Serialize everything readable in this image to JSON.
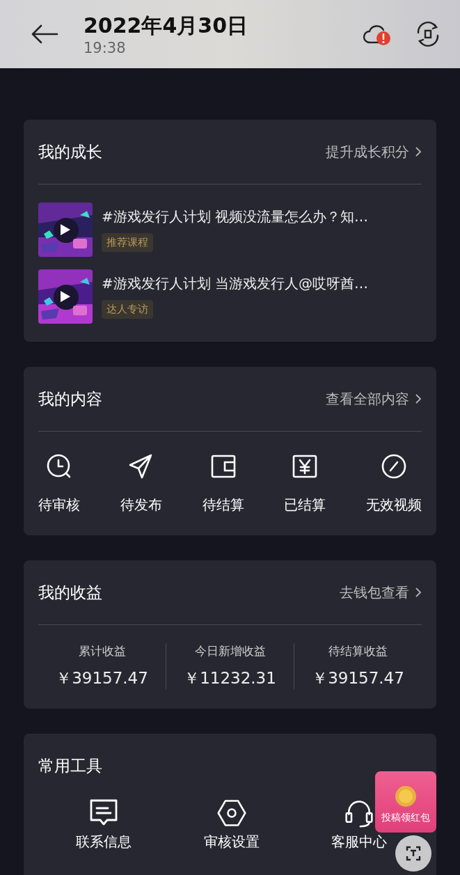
{
  "header": {
    "title": "2022年4月30日",
    "time": "19:38"
  },
  "growth": {
    "title": "我的成长",
    "link": "提升成长积分",
    "items": [
      {
        "title": "#游戏发行人计划 视频没流量怎么办？知…",
        "tag": "推荐课程"
      },
      {
        "title": "#游戏发行人计划 当游戏发行人@哎呀酋…",
        "tag": "达人专访"
      }
    ]
  },
  "content": {
    "title": "我的内容",
    "link": "查看全部内容",
    "items": [
      {
        "label": "待审核",
        "kind": "clock"
      },
      {
        "label": "待发布",
        "kind": "send"
      },
      {
        "label": "待结算",
        "kind": "wallet"
      },
      {
        "label": "已结算",
        "kind": "yen"
      },
      {
        "label": "无效视频",
        "kind": "ban"
      }
    ]
  },
  "income": {
    "title": "我的收益",
    "link": "去钱包查看",
    "stats": [
      {
        "label": "累计收益",
        "value": "￥39157.47"
      },
      {
        "label": "今日新增收益",
        "value": "￥11232.31"
      },
      {
        "label": "待结算收益",
        "value": "￥39157.47"
      }
    ]
  },
  "tools": {
    "title": "常用工具",
    "items": [
      {
        "label": "联系信息",
        "kind": "message"
      },
      {
        "label": "审核设置",
        "kind": "hexagon"
      },
      {
        "label": "客服中心",
        "kind": "headset"
      }
    ]
  },
  "promo": {
    "label": "投稿领红包"
  }
}
